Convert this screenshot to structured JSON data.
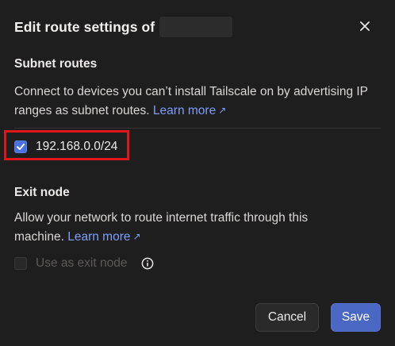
{
  "dialog": {
    "title": "Edit route settings of",
    "close_icon": "close-icon"
  },
  "subnet": {
    "heading": "Subnet routes",
    "description": "Connect to devices you can’t install Tailscale on by advertising IP ranges as subnet routes.",
    "learn_more": "Learn more",
    "learn_more_icon": "external-arrow-icon",
    "routes": [
      {
        "label": "192.168.0.0/24",
        "checked": true
      }
    ]
  },
  "exit_node": {
    "heading": "Exit node",
    "description": "Allow your network to route internet traffic through this machine.",
    "learn_more": "Learn more",
    "learn_more_icon": "external-arrow-icon",
    "checkbox_label": "Use as exit node",
    "checked": false,
    "disabled": true,
    "info_icon": "info-icon"
  },
  "footer": {
    "cancel_label": "Cancel",
    "save_label": "Save"
  },
  "colors": {
    "background": "#1f1e1e",
    "accent": "#4a67c4",
    "link": "#7d9ef8",
    "highlight": "#e0161c"
  }
}
